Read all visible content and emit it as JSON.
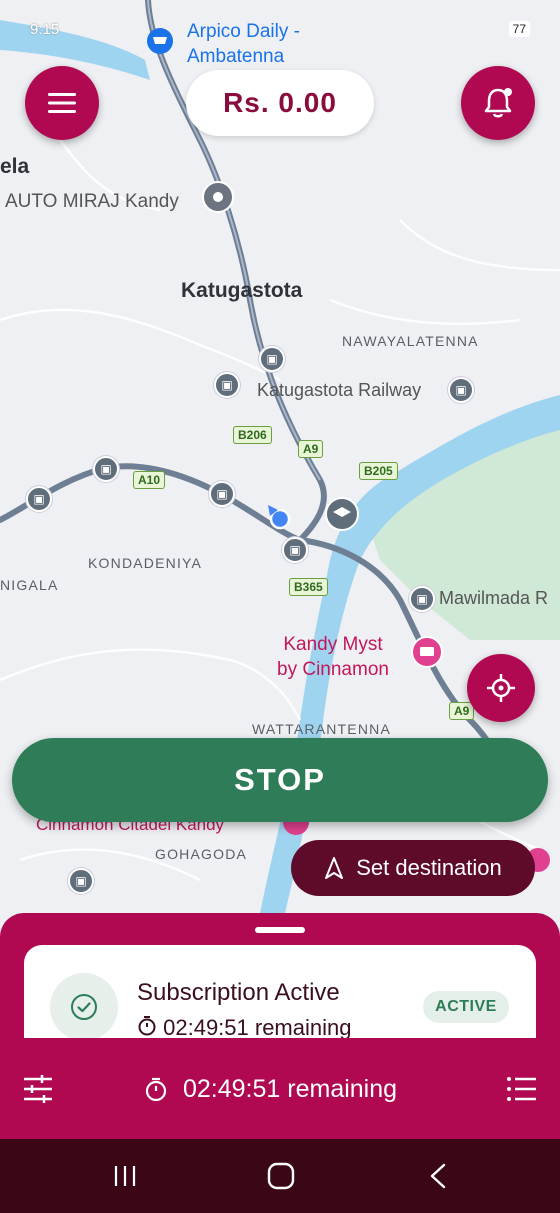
{
  "status_bar": {
    "time": "9:15",
    "battery": "77"
  },
  "fare": {
    "amount": "Rs. 0.00"
  },
  "map": {
    "places": {
      "arpico": "Arpico Daily -\nAmbatenna",
      "auto_miraj": "AUTO MIRAJ Kandy",
      "katugastota": "Katugastota",
      "nawayalatenna": "NAWAYALATENNA",
      "katugastota_railway": "Katugastota Railway",
      "kondadeniya": "KONDADENIYA",
      "nigala": "NIGALA",
      "mawilmada": "Mawilmada R",
      "kandy_myst": "Kandy Myst\nby Cinnamon",
      "wattarantenna": "WATTARANTENNA",
      "cinnamon_citadel": "Cinnamon Citadel Kandy",
      "gohagoda": "GOHAGODA",
      "ela": "ela"
    },
    "roads": {
      "b206": "B206",
      "a9_top": "A9",
      "b205": "B205",
      "a10": "A10",
      "b365": "B365",
      "a9_bottom": "A9"
    }
  },
  "actions": {
    "stop_label": "STOP",
    "set_destination_label": "Set destination"
  },
  "subscription": {
    "title": "Subscription Active",
    "remaining": "02:49:51 remaining",
    "badge": "ACTIVE"
  },
  "bottom_bar": {
    "timer": "02:49:51 remaining"
  },
  "colors": {
    "brand": "#b00952",
    "stop_green": "#2e7d58",
    "dark_maroon": "#5e0a2a"
  },
  "icons": [
    "menu-icon",
    "bell-icon",
    "locate-icon",
    "navigate-arrow-icon",
    "check-icon",
    "timer-icon",
    "filter-icon",
    "list-icon"
  ]
}
